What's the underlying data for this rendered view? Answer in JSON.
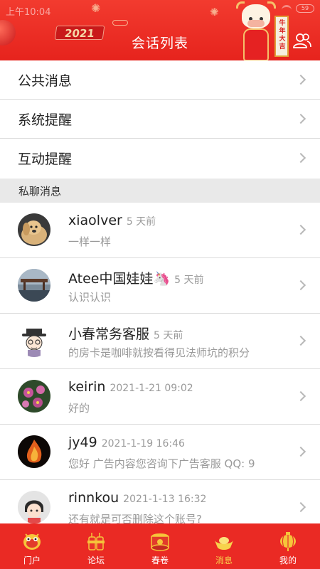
{
  "status_bar": {
    "time": "上午10:04",
    "battery": "59"
  },
  "header": {
    "title": "会话列表",
    "year_badge": "2021",
    "banner_text": "牛年大吉"
  },
  "menu": [
    {
      "label": "公共消息"
    },
    {
      "label": "系统提醒"
    },
    {
      "label": "互动提醒"
    }
  ],
  "section_title": "私聊消息",
  "chats": [
    {
      "name": "xiaolver",
      "time": "5 天前",
      "preview": "一样一样",
      "avatar": "dog-photo"
    },
    {
      "name": "Atee中国娃娃🦄",
      "time": "5 天前",
      "preview": "认识认识",
      "avatar": "bridge-photo"
    },
    {
      "name": "小春常务客服",
      "time": "5 天前",
      "preview": "的房卡是咖啡就按看得见法师坑的积分",
      "avatar": "cartoon-detective"
    },
    {
      "name": "keirin",
      "time": "2021-1-21 09:02",
      "preview": "好的",
      "avatar": "flower-photo"
    },
    {
      "name": "jy49",
      "time": "2021-1-19 16:46",
      "preview": "您好 广告内容您咨询下广告客服 QQ: 9",
      "avatar": "fire-photo"
    },
    {
      "name": "rinnkou",
      "time": "2021-1-13 16:32",
      "preview": "还有就是可否删除这个账号?",
      "avatar": "cartoon-girl"
    }
  ],
  "tabs": [
    {
      "label": "门户",
      "icon": "lion-dance-icon",
      "active": false
    },
    {
      "label": "论坛",
      "icon": "firecracker-icon",
      "active": false
    },
    {
      "label": "春卷",
      "icon": "drum-icon",
      "active": false
    },
    {
      "label": "消息",
      "icon": "gold-ingot-icon",
      "active": true
    },
    {
      "label": "我的",
      "icon": "lantern-icon",
      "active": false
    }
  ],
  "colors": {
    "primary_red": "#ea2a24",
    "active_tab": "#f7d24c",
    "section_bg": "#e9e9e9"
  }
}
